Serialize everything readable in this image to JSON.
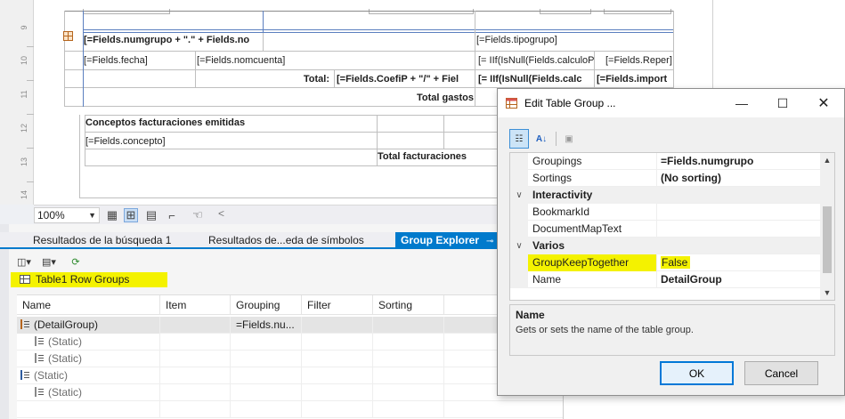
{
  "designer": {
    "ruler_numbers": [
      "9",
      "10",
      "11",
      "12",
      "13",
      "14"
    ],
    "cells": {
      "group_header": "[=Fields.numgrupo + \".\" + Fields.no",
      "tipogrupo": "[=Fields.tipogrupo]",
      "fecha": "[=Fields.fecha]",
      "nomcuenta": "[=Fields.nomcuenta]",
      "calculo": "[= IIf(IsNull(Fields.calculoP",
      "reper": "[=Fields.Reper]",
      "total_label": "Total:",
      "coefip": "[=Fields.CoefiP + \"/\" + Fiel",
      "calculo2": "[= IIf(IsNull(Fields.calc",
      "importe": "[=Fields.import",
      "total_gastos": "Total gastos",
      "conceptos_title": "Conceptos facturaciones emitidas",
      "concepto": "[=Fields.concepto]",
      "total_facturaciones": "Total facturaciones"
    }
  },
  "toolbar": {
    "zoom": "100%",
    "icons": [
      "grid-icon",
      "snap-icon",
      "table-icon",
      "ruler-icon",
      "hand-icon"
    ]
  },
  "tabs": [
    {
      "label": "Resultados de la búsqueda 1"
    },
    {
      "label": "Resultados de...eda de símbolos"
    },
    {
      "label": "Group Explorer",
      "pin": "⊸"
    }
  ],
  "group_explorer": {
    "title": "Table1 Row Groups",
    "columns": [
      "Name",
      "Item",
      "Grouping",
      "Filter",
      "Sorting"
    ],
    "rows": [
      {
        "name": "(DetailGroup)",
        "grouping": "=Fields.nu..."
      },
      {
        "name": "(Static)",
        "grouping": ""
      },
      {
        "name": "(Static)",
        "grouping": ""
      },
      {
        "name": "(Static)",
        "grouping": ""
      },
      {
        "name": "(Static)",
        "grouping": ""
      }
    ]
  },
  "dialog": {
    "title": "Edit Table Group ...",
    "properties": [
      {
        "name": "Groupings",
        "value": "=Fields.numgrupo"
      },
      {
        "name": "Sortings",
        "value": "(No sorting)"
      },
      {
        "name": "Interactivity",
        "category": true
      },
      {
        "name": "BookmarkId",
        "value": ""
      },
      {
        "name": "DocumentMapText",
        "value": ""
      },
      {
        "name": "Varios",
        "category": true
      },
      {
        "name": "GroupKeepTogether",
        "value": "False"
      },
      {
        "name": "Name",
        "value": "DetailGroup"
      }
    ],
    "description_title": "Name",
    "description_text": "Gets or sets the name of the table group.",
    "ok_label": "OK",
    "cancel_label": "Cancel"
  },
  "colors": {
    "highlight": "#f4f200",
    "accent": "#007acc"
  }
}
